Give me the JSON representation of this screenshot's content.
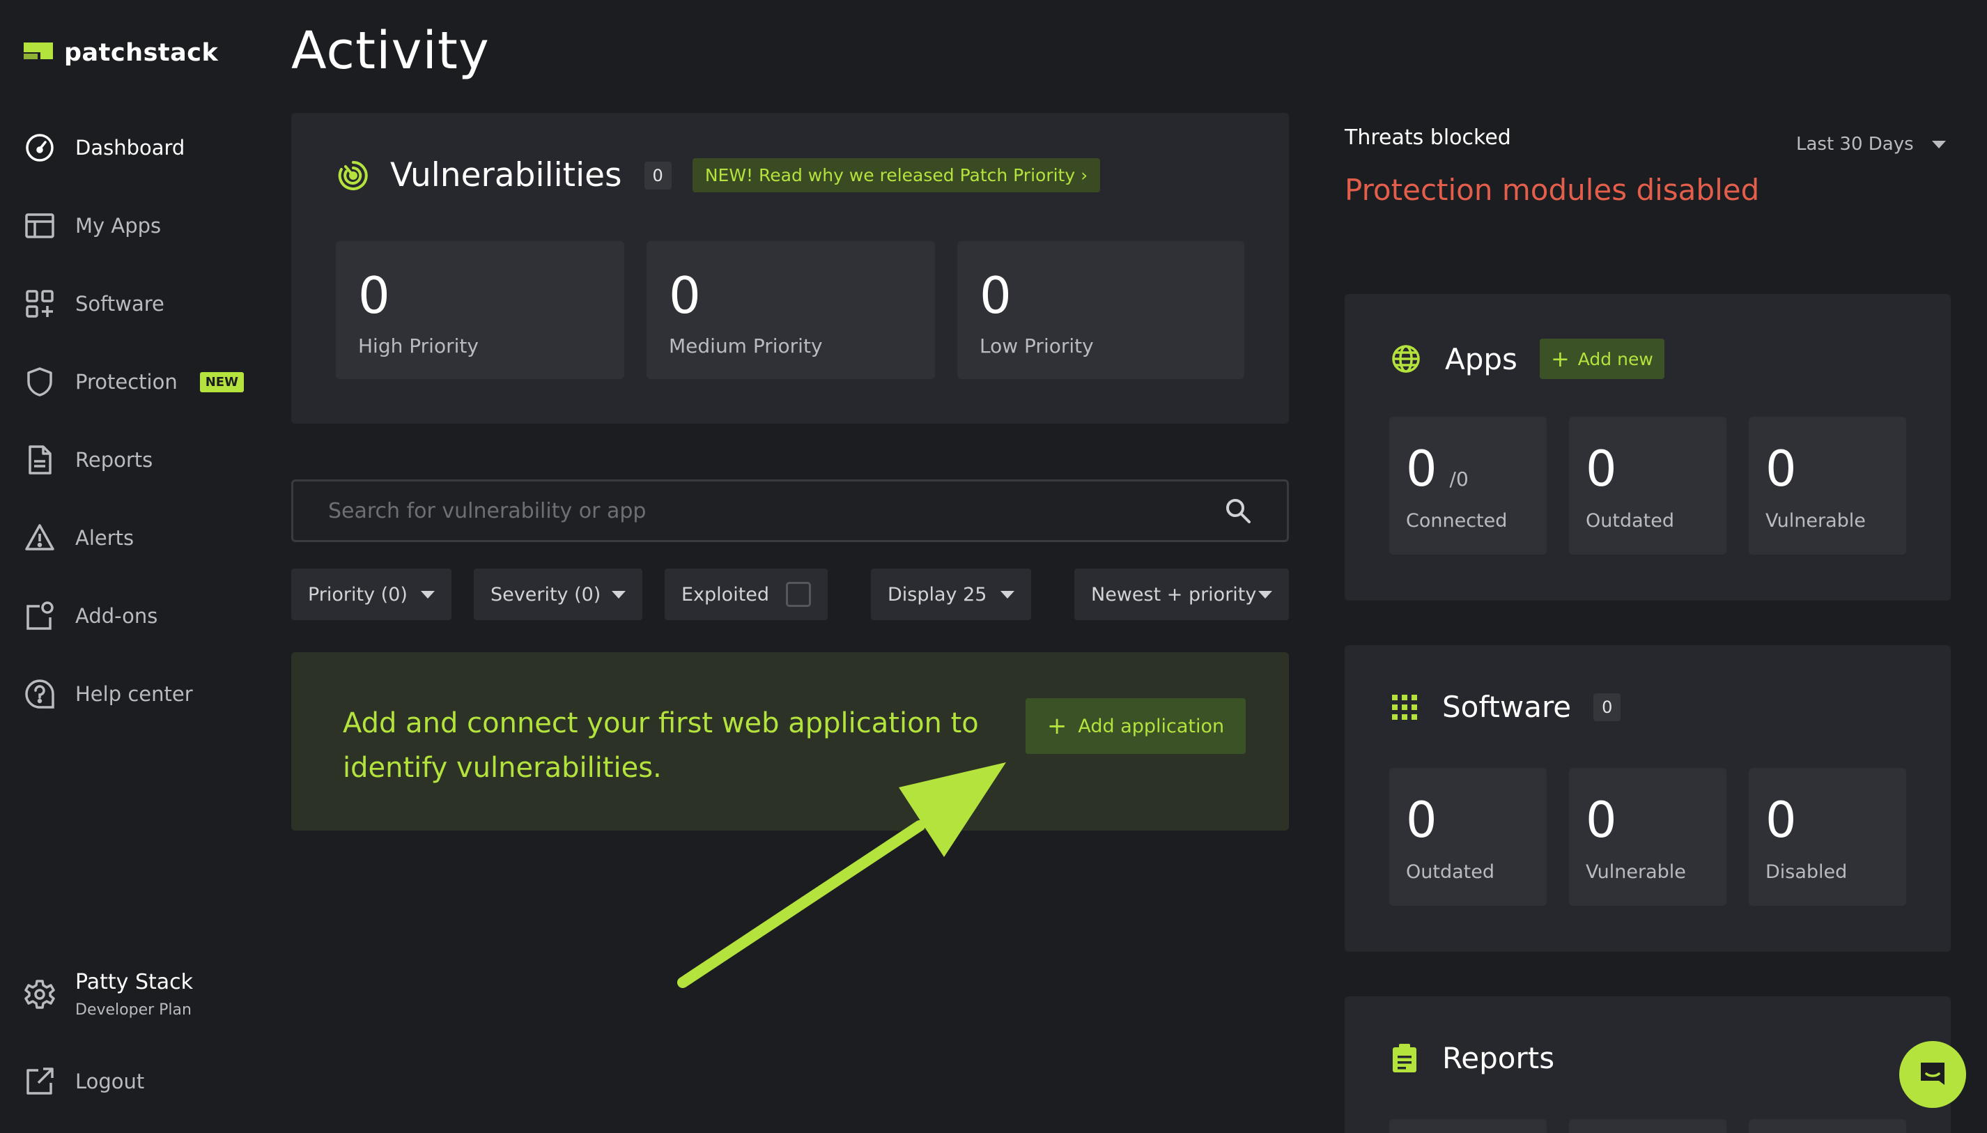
{
  "brand": {
    "name": "patchstack",
    "accent": "#b4e33d"
  },
  "sidebar": {
    "items": [
      {
        "label": "Dashboard",
        "icon": "dashboard-gauge-icon",
        "active": true
      },
      {
        "label": "My Apps",
        "icon": "apps-layout-icon"
      },
      {
        "label": "Software",
        "icon": "software-grid-plus-icon"
      },
      {
        "label": "Protection",
        "icon": "shield-icon",
        "badge": "NEW"
      },
      {
        "label": "Reports",
        "icon": "document-icon"
      },
      {
        "label": "Alerts",
        "icon": "warning-icon"
      },
      {
        "label": "Add-ons",
        "icon": "addons-icon"
      },
      {
        "label": "Help center",
        "icon": "help-circle-icon"
      }
    ],
    "user": {
      "name": "Patty Stack",
      "plan": "Developer Plan",
      "icon": "gear-icon"
    },
    "logout": {
      "label": "Logout",
      "icon": "external-link-icon"
    }
  },
  "page": {
    "title": "Activity"
  },
  "vulnerabilities": {
    "title": "Vulnerabilities",
    "count": "0",
    "promo": "NEW! Read why we released Patch Priority",
    "stats": [
      {
        "value": "0",
        "label": "High Priority"
      },
      {
        "value": "0",
        "label": "Medium Priority"
      },
      {
        "value": "0",
        "label": "Low Priority"
      }
    ]
  },
  "search": {
    "placeholder": "Search for vulnerability or app"
  },
  "filters": {
    "priority": "Priority (0)",
    "severity": "Severity (0)",
    "exploited": "Exploited",
    "display": "Display 25",
    "sort": "Newest + priority"
  },
  "cta": {
    "text": "Add and connect your first web application to identify vulnerabilities.",
    "button": "Add application"
  },
  "threats": {
    "title": "Threats blocked",
    "range": "Last 30 Days",
    "status": "Protection modules disabled",
    "status_color": "#e35e4b"
  },
  "apps": {
    "title": "Apps",
    "add_label": "Add new",
    "stats": [
      {
        "value": "0",
        "sub": "/0",
        "label": "Connected"
      },
      {
        "value": "0",
        "label": "Outdated"
      },
      {
        "value": "0",
        "label": "Vulnerable"
      }
    ]
  },
  "software": {
    "title": "Software",
    "count": "0",
    "stats": [
      {
        "value": "0",
        "label": "Outdated"
      },
      {
        "value": "0",
        "label": "Vulnerable"
      },
      {
        "value": "0",
        "label": "Disabled"
      }
    ]
  },
  "reports": {
    "title": "Reports"
  }
}
